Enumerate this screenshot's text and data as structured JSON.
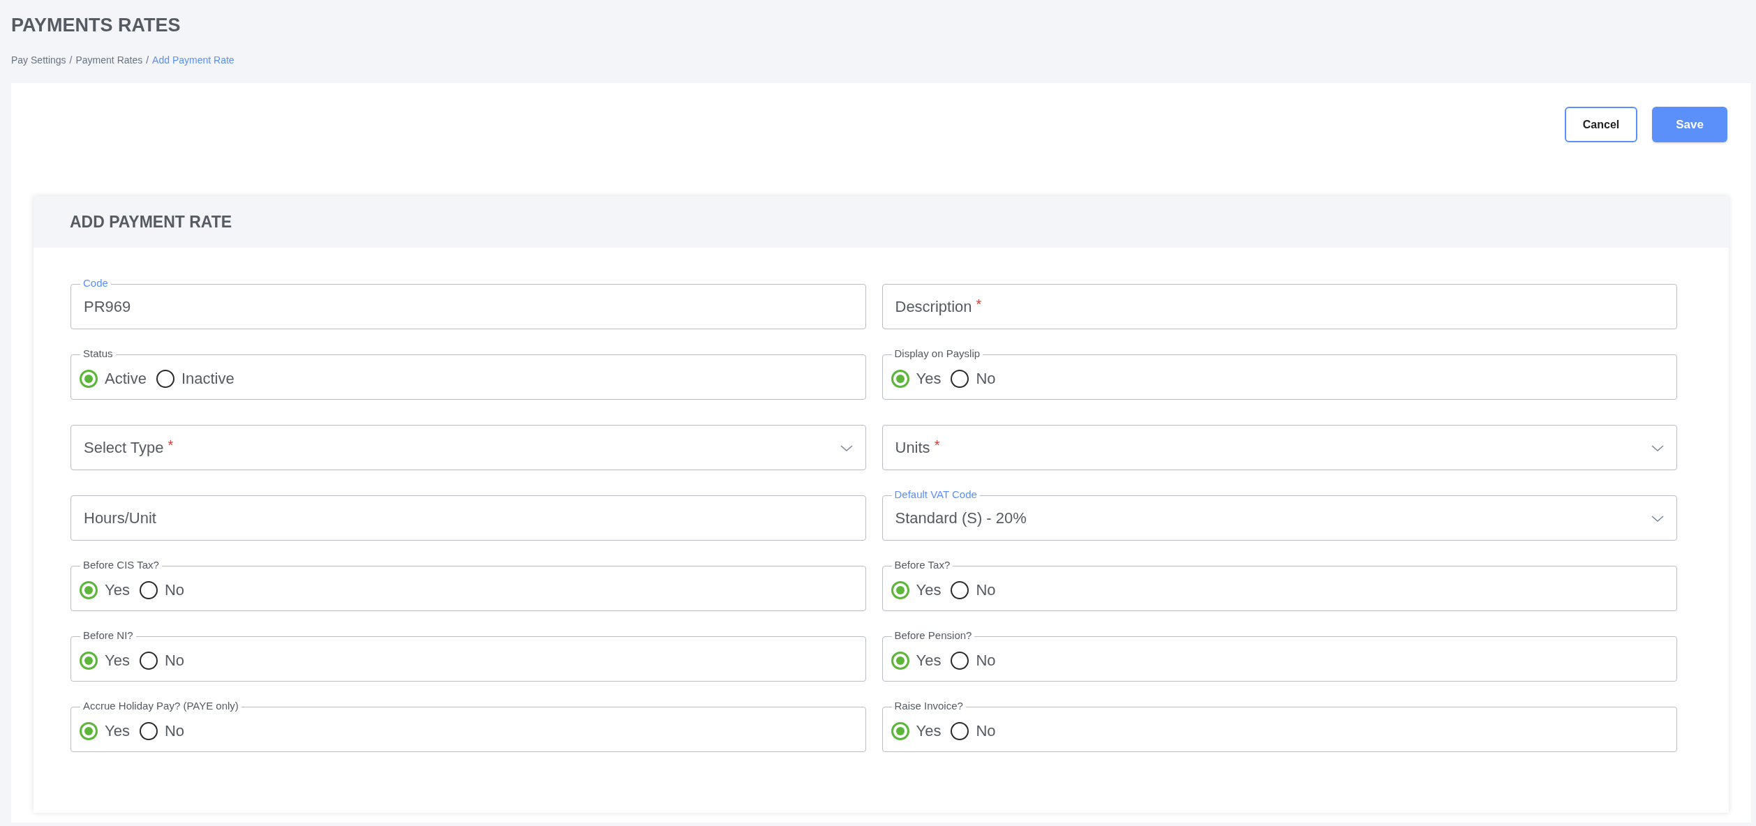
{
  "page_title": "PAYMENTS RATES",
  "breadcrumb": [
    {
      "label": "Pay Settings",
      "current": false
    },
    {
      "label": "Payment Rates",
      "current": false
    },
    {
      "label": "Add Payment Rate",
      "current": true
    }
  ],
  "breadcrumb_separator": "/",
  "buttons": [
    {
      "label": "Cancel",
      "kind": "secondary"
    },
    {
      "label": "Save",
      "kind": "primary"
    }
  ],
  "card": {
    "title": "ADD PAYMENT RATE",
    "required_mark": "*",
    "rows": [
      [
        {
          "kind": "text",
          "label": "Code",
          "value": "PR969",
          "required": false
        },
        {
          "kind": "text",
          "placeholder": "Description",
          "required": true
        }
      ],
      [
        {
          "kind": "radio",
          "label": "Status",
          "required": false,
          "options": [
            {
              "label": "Active",
              "selected": true
            },
            {
              "label": "Inactive",
              "selected": false
            }
          ]
        },
        {
          "kind": "radio",
          "label": "Display on Payslip",
          "required": false,
          "options": [
            {
              "label": "Yes",
              "selected": true
            },
            {
              "label": "No",
              "selected": false
            }
          ]
        }
      ],
      [
        {
          "kind": "select",
          "placeholder": "Select Type",
          "required": true
        },
        {
          "kind": "select",
          "placeholder": "Units",
          "required": true
        }
      ],
      [
        {
          "kind": "text",
          "placeholder": "Hours/Unit",
          "required": false
        },
        {
          "kind": "select",
          "label": "Default VAT Code",
          "value": "Standard (S) - 20%",
          "required": false
        }
      ],
      [
        {
          "kind": "radio",
          "label": "Before CIS Tax?",
          "required": false,
          "options": [
            {
              "label": "Yes",
              "selected": true
            },
            {
              "label": "No",
              "selected": false
            }
          ]
        },
        {
          "kind": "radio",
          "label": "Before Tax?",
          "required": false,
          "options": [
            {
              "label": "Yes",
              "selected": true
            },
            {
              "label": "No",
              "selected": false
            }
          ]
        }
      ],
      [
        {
          "kind": "radio",
          "label": "Before NI?",
          "required": false,
          "options": [
            {
              "label": "Yes",
              "selected": true
            },
            {
              "label": "No",
              "selected": false
            }
          ]
        },
        {
          "kind": "radio",
          "label": "Before Pension?",
          "required": false,
          "options": [
            {
              "label": "Yes",
              "selected": true
            },
            {
              "label": "No",
              "selected": false
            }
          ]
        }
      ],
      [
        {
          "kind": "radio",
          "label": "Accrue Holiday Pay? (PAYE only)",
          "required": false,
          "options": [
            {
              "label": "Yes",
              "selected": true
            },
            {
              "label": "No",
              "selected": false
            }
          ]
        },
        {
          "kind": "radio",
          "label": "Raise Invoice?",
          "required": false,
          "options": [
            {
              "label": "Yes",
              "selected": true
            },
            {
              "label": "No",
              "selected": false
            }
          ]
        }
      ]
    ]
  }
}
